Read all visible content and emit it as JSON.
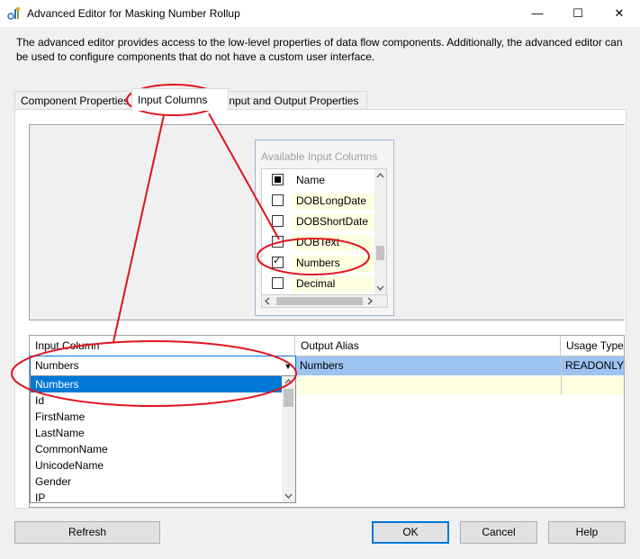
{
  "window": {
    "title": "Advanced Editor for Masking Number Rollup",
    "minimize_glyph": "—",
    "maximize_glyph": "☐",
    "close_glyph": "✕"
  },
  "description": "The advanced editor provides access to the low-level properties of data flow components. Additionally, the advanced editor can be used to configure components that do not have a custom user interface.",
  "tabs": [
    {
      "label": "Component Properties",
      "active": false
    },
    {
      "label": "Input Columns",
      "active": true
    },
    {
      "label": "Input and Output Properties",
      "active": false
    }
  ],
  "available_columns": {
    "title": "Available Input Columns",
    "header": "Name",
    "items": [
      {
        "label": "DOBLongDate",
        "checked": false
      },
      {
        "label": "DOBShortDate",
        "checked": false
      },
      {
        "label": "DOBText",
        "checked": false
      },
      {
        "label": "Numbers",
        "checked": true
      },
      {
        "label": "Decimal",
        "checked": false
      }
    ]
  },
  "grid": {
    "columns": [
      "Input Column",
      "Output Alias",
      "Usage Type"
    ],
    "selected_row": {
      "input_column": "Numbers",
      "output_alias": "Numbers",
      "usage_type": "READONLY"
    }
  },
  "dropdown": {
    "items": [
      "Numbers",
      "Id",
      "FirstName",
      "LastName",
      "CommonName",
      "UnicodeName",
      "Gender",
      "IP"
    ],
    "selected": "Numbers"
  },
  "buttons": {
    "refresh": "Refresh",
    "ok": "OK",
    "cancel": "Cancel",
    "help": "Help"
  },
  "colors": {
    "selection_blue": "#0078d7",
    "row_highlight": "#9dc3f0",
    "new_row_yellow": "#ffffe1",
    "annotation_red": "#e0141e"
  }
}
